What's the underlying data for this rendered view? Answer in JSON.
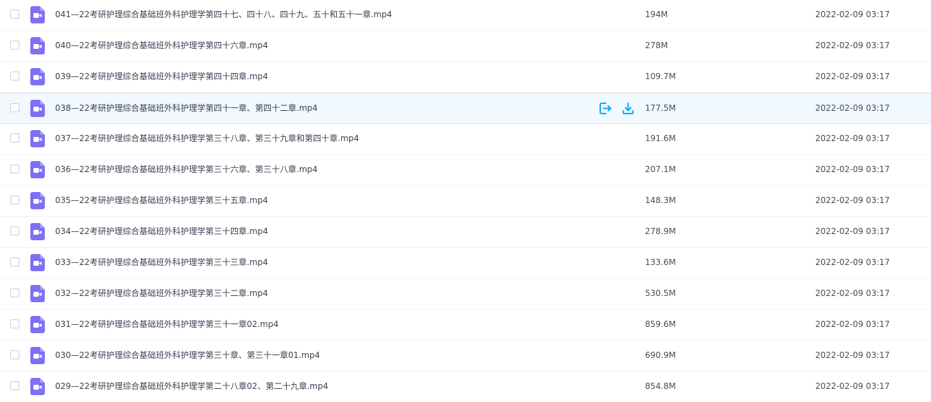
{
  "colors": {
    "accent": "#06a7ff",
    "icon_purple": "#7e6ff5",
    "hover_bg": "#f1f8fe"
  },
  "hover_actions": {
    "move_icon": "move-to-icon",
    "download_icon": "download-icon"
  },
  "files": [
    {
      "name": "041—22考研护理综合基础班外科护理学第四十七、四十八、四十九、五十和五十一章.mp4",
      "size": "194M",
      "date": "2022-02-09 03:17"
    },
    {
      "name": "040—22考研护理综合基础班外科护理学第四十六章.mp4",
      "size": "278M",
      "date": "2022-02-09 03:17"
    },
    {
      "name": "039—22考研护理综合基础班外科护理学第四十四章.mp4",
      "size": "109.7M",
      "date": "2022-02-09 03:17"
    },
    {
      "name": "038—22考研护理综合基础班外科护理学第四十一章、第四十二章.mp4",
      "size": "177.5M",
      "date": "2022-02-09 03:17",
      "hover": true
    },
    {
      "name": "037—22考研护理综合基础班外科护理学第三十八章、第三十九章和第四十章.mp4",
      "size": "191.6M",
      "date": "2022-02-09 03:17"
    },
    {
      "name": "036—22考研护理综合基础班外科护理学第三十六章、第三十八章.mp4",
      "size": "207.1M",
      "date": "2022-02-09 03:17"
    },
    {
      "name": "035—22考研护理综合基础班外科护理学第三十五章.mp4",
      "size": "148.3M",
      "date": "2022-02-09 03:17"
    },
    {
      "name": "034—22考研护理综合基础班外科护理学第三十四章.mp4",
      "size": "278.9M",
      "date": "2022-02-09 03:17"
    },
    {
      "name": "033—22考研护理综合基础班外科护理学第三十三章.mp4",
      "size": "133.6M",
      "date": "2022-02-09 03:17"
    },
    {
      "name": "032—22考研护理综合基础班外科护理学第三十二章.mp4",
      "size": "530.5M",
      "date": "2022-02-09 03:17"
    },
    {
      "name": "031—22考研护理综合基础班外科护理学第三十一章02.mp4",
      "size": "859.6M",
      "date": "2022-02-09 03:17"
    },
    {
      "name": "030—22考研护理综合基础班外科护理学第三十章、第三十一章01.mp4",
      "size": "690.9M",
      "date": "2022-02-09 03:17"
    },
    {
      "name": "029—22考研护理综合基础班外科护理学第二十八章02、第二十九章.mp4",
      "size": "854.8M",
      "date": "2022-02-09 03:17"
    }
  ]
}
